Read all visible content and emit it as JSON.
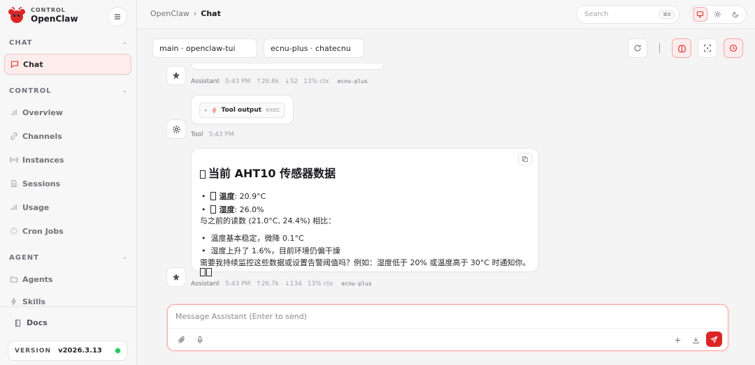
{
  "brand": {
    "small": "CONTROL",
    "name": "OpenClaw"
  },
  "sidebar": {
    "sections": [
      {
        "label": "CHAT"
      },
      {
        "label": "CONTROL"
      },
      {
        "label": "AGENT"
      }
    ],
    "items": [
      {
        "label": "Chat",
        "icon": "chat-icon",
        "active": true
      },
      {
        "label": "Overview",
        "icon": "bar-chart-icon"
      },
      {
        "label": "Channels",
        "icon": "link-icon"
      },
      {
        "label": "Instances",
        "icon": "radio-icon"
      },
      {
        "label": "Sessions",
        "icon": "document-icon"
      },
      {
        "label": "Usage",
        "icon": "bar-chart-icon"
      },
      {
        "label": "Cron Jobs",
        "icon": "loader-icon"
      },
      {
        "label": "Agents",
        "icon": "folder-icon"
      },
      {
        "label": "Skills",
        "icon": "zap-icon"
      }
    ],
    "docs_label": "Docs",
    "version_label": "VERSION",
    "version_value": "v2026.3.13",
    "status_color": "#22c55e"
  },
  "header": {
    "breadcrumb_root": "OpenClaw",
    "breadcrumb_sep": "›",
    "breadcrumb_current": "Chat",
    "search_placeholder": "Search",
    "search_shortcut": "⌘K"
  },
  "session": {
    "session_select": "main · openclaw-tui",
    "model_select": "ecnu-plus · chatecnu"
  },
  "messages": {
    "m1": {
      "who": "Assistant",
      "time": "5:43 PM",
      "up": "↑26.6k",
      "down": "↓52",
      "ctx": "13% ctx",
      "model": "ecnu-plus"
    },
    "tool": {
      "arrow": "▸",
      "label": "Tool output",
      "kind": "exec",
      "who": "Tool",
      "time": "5:43 PM"
    },
    "m2": {
      "title": "当前 AHT10 传感器数据",
      "temp_label": "温度",
      "temp_value": ": 20.9°C",
      "hum_label": "湿度",
      "hum_value": ": 26.0%",
      "compare": "与之前的读数 (21.0°C, 24.4%) 相比：",
      "bullet1": "温度基本稳定，微降 0.1°C",
      "bullet2": "湿度上升了 1.6%，目前环境仍偏干燥",
      "question": "需要我持续监控这些数据或设置告警阈值吗？例如：湿度低于 20% 或温度高于 30°C 时通知你。",
      "who": "Assistant",
      "time": "5:43 PM",
      "up": "↑26.7k",
      "down": "↓134",
      "ctx": "13% ctx",
      "model": "ecnu-plus"
    }
  },
  "composer": {
    "placeholder": "Message Assistant (Enter to send)"
  },
  "colors": {
    "accent": "#dc2626",
    "accent_soft": "#fdecec"
  }
}
